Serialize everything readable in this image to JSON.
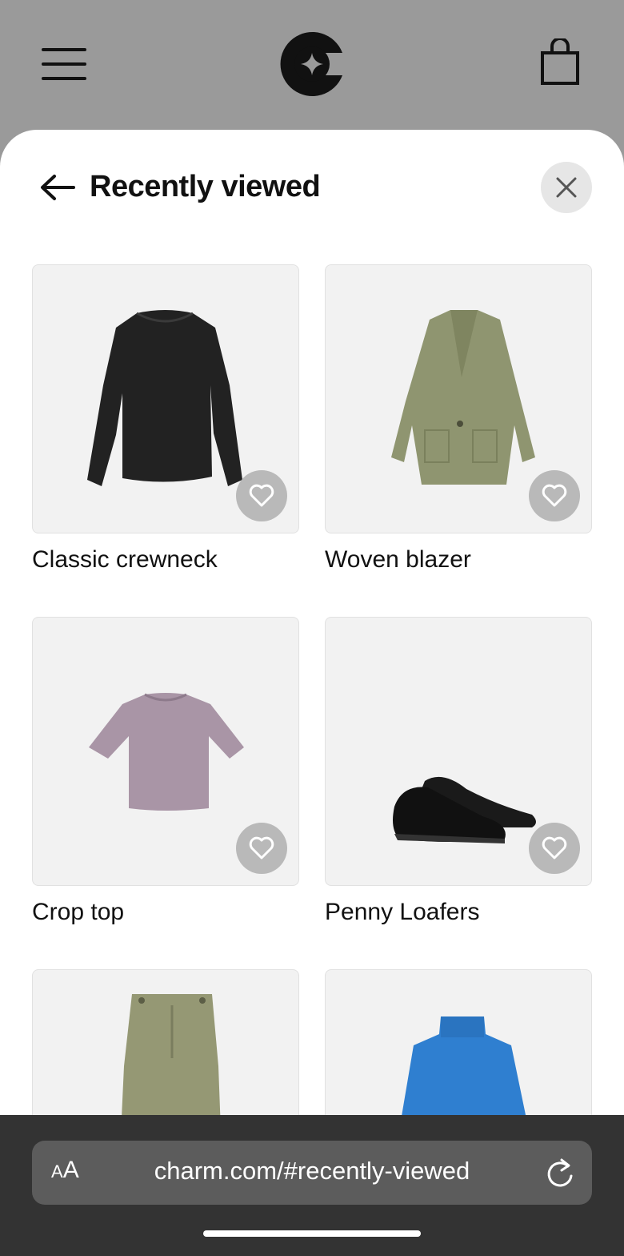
{
  "header": {
    "menu_icon": "hamburger-menu-icon",
    "logo_icon": "charm-logo-icon",
    "bag_icon": "shopping-bag-icon"
  },
  "sheet": {
    "title": "Recently viewed",
    "back_icon": "arrow-left-icon",
    "close_icon": "close-icon"
  },
  "products": [
    {
      "name": "Classic crewneck",
      "image_icon": "black-sweater",
      "color": "#1f1f1f"
    },
    {
      "name": "Woven blazer",
      "image_icon": "olive-blazer",
      "color": "#8f9570"
    },
    {
      "name": "Crop top",
      "image_icon": "lilac-crop-top",
      "color": "#a995a6"
    },
    {
      "name": "Penny Loafers",
      "image_icon": "black-loafers",
      "color": "#151515"
    },
    {
      "name": "",
      "image_icon": "olive-skirt",
      "color": "#959874"
    },
    {
      "name": "",
      "image_icon": "blue-turtleneck",
      "color": "#2f7fd0"
    }
  ],
  "browser": {
    "text_size_label_small": "A",
    "text_size_label_large": "A",
    "url": "charm.com/#recently-viewed",
    "reload_icon": "reload-icon"
  }
}
